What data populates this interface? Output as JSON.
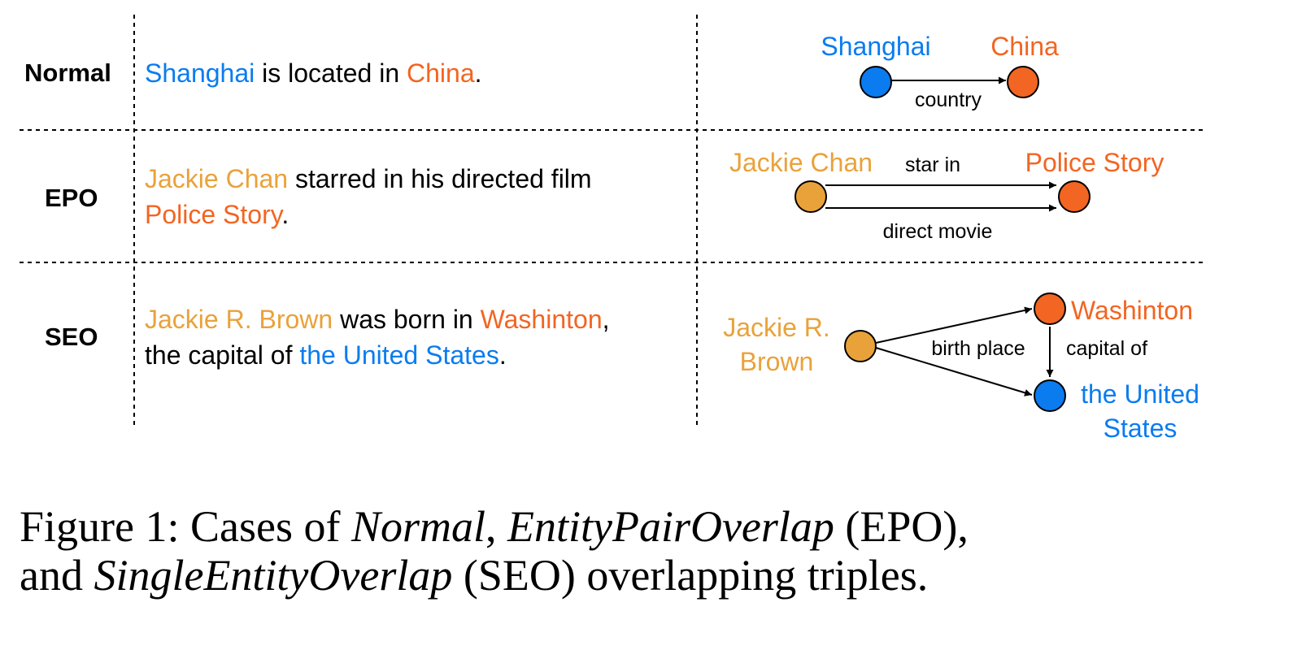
{
  "rows": [
    {
      "label": "Normal",
      "sentence": {
        "e1": "Shanghai",
        "t1": " is located in ",
        "e2": "China",
        "t2": "."
      },
      "graph": {
        "head": "Shanghai",
        "tail": "China",
        "relation": "country"
      }
    },
    {
      "label": "EPO",
      "sentence": {
        "e1": "Jackie Chan",
        "t1": " starred in his directed film",
        "e2": "Police Story",
        "t2": "."
      },
      "graph": {
        "head": "Jackie Chan",
        "tail": "Police Story",
        "relation1": "star in",
        "relation2": "direct movie"
      }
    },
    {
      "label": "SEO",
      "sentence": {
        "e1": "Jackie R. Brown",
        "t1": " was born in ",
        "e2": "Washinton",
        "t2": ",",
        "t3": "the capital of ",
        "e3": "the United States",
        "t4": "."
      },
      "graph": {
        "head_line1": "Jackie R.",
        "head_line2": "Brown",
        "mid": "Washinton",
        "tail_line1": "the United",
        "tail_line2": "States",
        "relation1": "birth place",
        "relation2": "capital of"
      }
    }
  ],
  "caption": {
    "prefix": "Figure 1:  Cases of ",
    "normal": "Normal",
    "sep1": ", ",
    "epo": "EntityPairOverlap",
    "after_epo": " (EPO),",
    "line2_start": "and ",
    "seo": "SingleEntityOverlap",
    "after_seo": " (SEO) overlapping triples."
  },
  "colors": {
    "blue": "#0a7cf0",
    "orange": "#f26522",
    "amber": "#e9a23a"
  }
}
